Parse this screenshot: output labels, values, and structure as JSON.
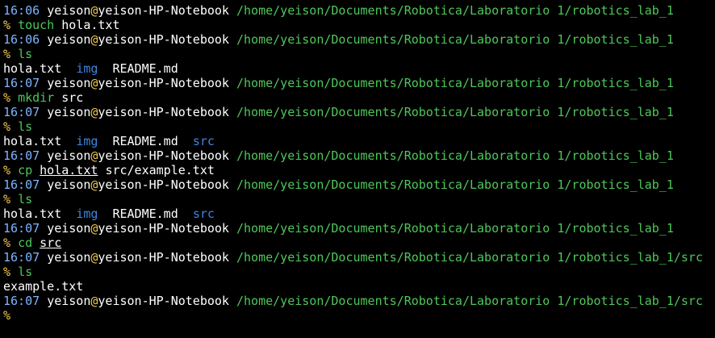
{
  "colors": {
    "background": "#000000",
    "time": "#7fb4ff",
    "at_sign": "#f2c94c",
    "path": "#4ec75a",
    "prompt_symbol": "#f2c94c",
    "command": "#4ec75a",
    "directory": "#3d86e0",
    "text": "#ffffff"
  },
  "prompt": {
    "user": "yeison",
    "at": "@",
    "host": "yeison-HP-Notebook",
    "symbol": "%"
  },
  "lines": [
    {
      "kind": "prompt",
      "time": "16:06",
      "path": "/home/yeison/Documents/Robotica/Laboratorio 1/robotics_lab_1"
    },
    {
      "kind": "command",
      "cmd": "touch",
      "args": [
        {
          "text": "hola.txt",
          "underline": false
        }
      ]
    },
    {
      "kind": "prompt",
      "time": "16:06",
      "path": "/home/yeison/Documents/Robotica/Laboratorio 1/robotics_lab_1"
    },
    {
      "kind": "command",
      "cmd": "ls",
      "args": []
    },
    {
      "kind": "output",
      "items": [
        {
          "text": "hola.txt",
          "type": "file"
        },
        {
          "text": "img",
          "type": "dir"
        },
        {
          "text": "README.md",
          "type": "file"
        }
      ]
    },
    {
      "kind": "prompt",
      "time": "16:07",
      "path": "/home/yeison/Documents/Robotica/Laboratorio 1/robotics_lab_1"
    },
    {
      "kind": "command",
      "cmd": "mkdir",
      "args": [
        {
          "text": "src",
          "underline": false
        }
      ]
    },
    {
      "kind": "prompt",
      "time": "16:07",
      "path": "/home/yeison/Documents/Robotica/Laboratorio 1/robotics_lab_1"
    },
    {
      "kind": "command",
      "cmd": "ls",
      "args": []
    },
    {
      "kind": "output",
      "items": [
        {
          "text": "hola.txt",
          "type": "file"
        },
        {
          "text": "img",
          "type": "dir"
        },
        {
          "text": "README.md",
          "type": "file"
        },
        {
          "text": "src",
          "type": "dir"
        }
      ]
    },
    {
      "kind": "prompt",
      "time": "16:07",
      "path": "/home/yeison/Documents/Robotica/Laboratorio 1/robotics_lab_1"
    },
    {
      "kind": "command",
      "cmd": "cp",
      "args": [
        {
          "text": "hola.txt",
          "underline": true
        },
        {
          "text": "src/example.txt",
          "underline": false
        }
      ]
    },
    {
      "kind": "prompt",
      "time": "16:07",
      "path": "/home/yeison/Documents/Robotica/Laboratorio 1/robotics_lab_1"
    },
    {
      "kind": "command",
      "cmd": "ls",
      "args": []
    },
    {
      "kind": "output",
      "items": [
        {
          "text": "hola.txt",
          "type": "file"
        },
        {
          "text": "img",
          "type": "dir"
        },
        {
          "text": "README.md",
          "type": "file"
        },
        {
          "text": "src",
          "type": "dir"
        }
      ]
    },
    {
      "kind": "prompt",
      "time": "16:07",
      "path": "/home/yeison/Documents/Robotica/Laboratorio 1/robotics_lab_1"
    },
    {
      "kind": "command",
      "cmd": "cd",
      "args": [
        {
          "text": "src",
          "underline": true
        }
      ]
    },
    {
      "kind": "prompt",
      "time": "16:07",
      "path": "/home/yeison/Documents/Robotica/Laboratorio 1/robotics_lab_1/src"
    },
    {
      "kind": "command",
      "cmd": "ls",
      "args": []
    },
    {
      "kind": "output",
      "items": [
        {
          "text": "example.txt",
          "type": "file"
        }
      ]
    },
    {
      "kind": "prompt",
      "time": "16:07",
      "path": "/home/yeison/Documents/Robotica/Laboratorio 1/robotics_lab_1/src"
    },
    {
      "kind": "command",
      "cmd": "",
      "args": []
    }
  ]
}
